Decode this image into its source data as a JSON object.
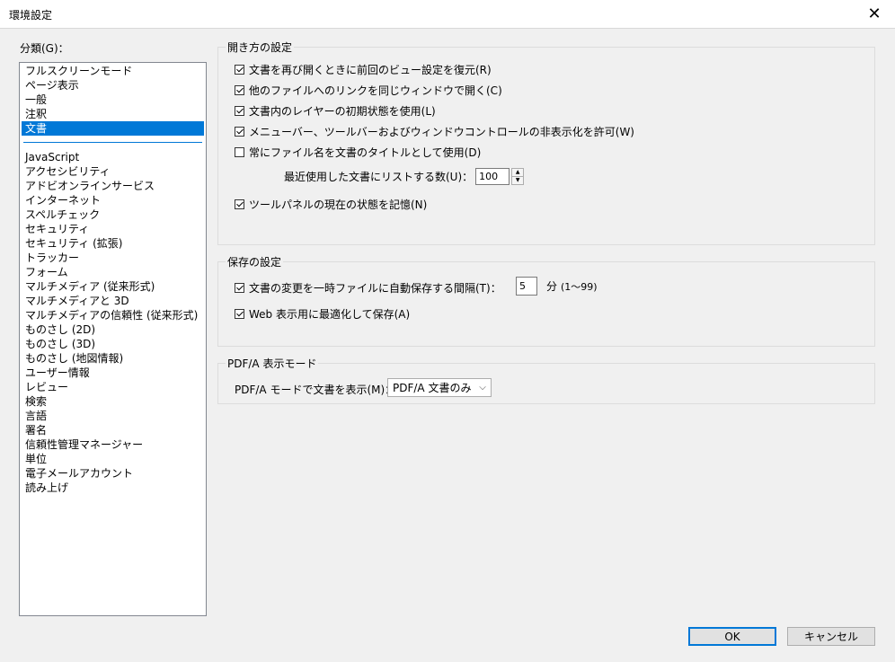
{
  "window": {
    "title": "環境設定",
    "close_glyph": "✕"
  },
  "categories": {
    "label": "分類(G)：",
    "group1": [
      "フルスクリーンモード",
      "ページ表示",
      "一般",
      "注釈",
      "文書"
    ],
    "selected": "文書",
    "group2": [
      "JavaScript",
      "アクセシビリティ",
      "アドビオンラインサービス",
      "インターネット",
      "スペルチェック",
      "セキュリティ",
      "セキュリティ (拡張)",
      "トラッカー",
      "フォーム",
      "マルチメディア (従来形式)",
      "マルチメディアと 3D",
      "マルチメディアの信頼性 (従来形式)",
      "ものさし (2D)",
      "ものさし (3D)",
      "ものさし (地図情報)",
      "ユーザー情報",
      "レビュー",
      "検索",
      "言語",
      "署名",
      "信頼性管理マネージャー",
      "単位",
      "電子メールアカウント",
      "読み上げ"
    ]
  },
  "open_settings": {
    "legend": "開き方の設定",
    "restore_view": {
      "label": "文書を再び開くときに前回のビュー設定を復元(R)",
      "checked": true
    },
    "same_window": {
      "label": "他のファイルへのリンクを同じウィンドウで開く(C)",
      "checked": true
    },
    "layer_state": {
      "label": "文書内のレイヤーの初期状態を使用(L)",
      "checked": true
    },
    "hide_controls": {
      "label": "メニューバー、ツールバーおよびウィンドウコントロールの非表示化を許可(W)",
      "checked": true
    },
    "filename_title": {
      "label": "常にファイル名を文書のタイトルとして使用(D)",
      "checked": false
    },
    "recent_label": "最近使用した文書にリストする数(U)：",
    "recent_value": "100",
    "toolpanel_state": {
      "label": "ツールパネルの現在の状態を記憶(N)",
      "checked": true
    }
  },
  "save_settings": {
    "legend": "保存の設定",
    "autosave": {
      "label": "文書の変更を一時ファイルに自動保存する間隔(T)：",
      "checked": true
    },
    "autosave_value": "5",
    "autosave_unit": "分",
    "autosave_range": "(1〜99)",
    "web_optimize": {
      "label": "Web 表示用に最適化して保存(A)",
      "checked": true
    }
  },
  "pdfa": {
    "legend": "PDF/A 表示モード",
    "label": "PDF/A モードで文書を表示(M)：",
    "selected": "PDF/A 文書のみ"
  },
  "buttons": {
    "ok": "OK",
    "cancel": "キャンセル"
  }
}
